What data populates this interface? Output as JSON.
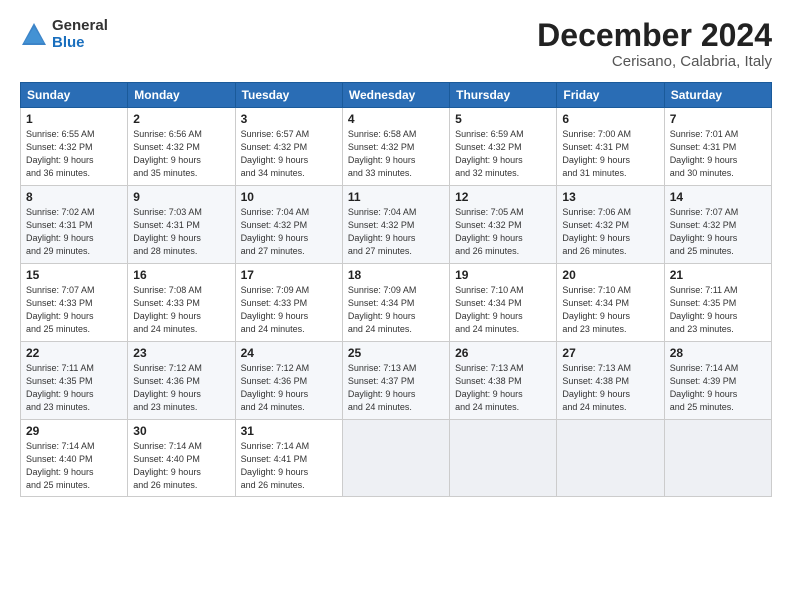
{
  "logo": {
    "general": "General",
    "blue": "Blue"
  },
  "title": "December 2024",
  "subtitle": "Cerisano, Calabria, Italy",
  "header_days": [
    "Sunday",
    "Monday",
    "Tuesday",
    "Wednesday",
    "Thursday",
    "Friday",
    "Saturday"
  ],
  "weeks": [
    [
      {
        "day": "1",
        "detail": "Sunrise: 6:55 AM\nSunset: 4:32 PM\nDaylight: 9 hours\nand 36 minutes."
      },
      {
        "day": "2",
        "detail": "Sunrise: 6:56 AM\nSunset: 4:32 PM\nDaylight: 9 hours\nand 35 minutes."
      },
      {
        "day": "3",
        "detail": "Sunrise: 6:57 AM\nSunset: 4:32 PM\nDaylight: 9 hours\nand 34 minutes."
      },
      {
        "day": "4",
        "detail": "Sunrise: 6:58 AM\nSunset: 4:32 PM\nDaylight: 9 hours\nand 33 minutes."
      },
      {
        "day": "5",
        "detail": "Sunrise: 6:59 AM\nSunset: 4:32 PM\nDaylight: 9 hours\nand 32 minutes."
      },
      {
        "day": "6",
        "detail": "Sunrise: 7:00 AM\nSunset: 4:31 PM\nDaylight: 9 hours\nand 31 minutes."
      },
      {
        "day": "7",
        "detail": "Sunrise: 7:01 AM\nSunset: 4:31 PM\nDaylight: 9 hours\nand 30 minutes."
      }
    ],
    [
      {
        "day": "8",
        "detail": "Sunrise: 7:02 AM\nSunset: 4:31 PM\nDaylight: 9 hours\nand 29 minutes."
      },
      {
        "day": "9",
        "detail": "Sunrise: 7:03 AM\nSunset: 4:31 PM\nDaylight: 9 hours\nand 28 minutes."
      },
      {
        "day": "10",
        "detail": "Sunrise: 7:04 AM\nSunset: 4:32 PM\nDaylight: 9 hours\nand 27 minutes."
      },
      {
        "day": "11",
        "detail": "Sunrise: 7:04 AM\nSunset: 4:32 PM\nDaylight: 9 hours\nand 27 minutes."
      },
      {
        "day": "12",
        "detail": "Sunrise: 7:05 AM\nSunset: 4:32 PM\nDaylight: 9 hours\nand 26 minutes."
      },
      {
        "day": "13",
        "detail": "Sunrise: 7:06 AM\nSunset: 4:32 PM\nDaylight: 9 hours\nand 26 minutes."
      },
      {
        "day": "14",
        "detail": "Sunrise: 7:07 AM\nSunset: 4:32 PM\nDaylight: 9 hours\nand 25 minutes."
      }
    ],
    [
      {
        "day": "15",
        "detail": "Sunrise: 7:07 AM\nSunset: 4:33 PM\nDaylight: 9 hours\nand 25 minutes."
      },
      {
        "day": "16",
        "detail": "Sunrise: 7:08 AM\nSunset: 4:33 PM\nDaylight: 9 hours\nand 24 minutes."
      },
      {
        "day": "17",
        "detail": "Sunrise: 7:09 AM\nSunset: 4:33 PM\nDaylight: 9 hours\nand 24 minutes."
      },
      {
        "day": "18",
        "detail": "Sunrise: 7:09 AM\nSunset: 4:34 PM\nDaylight: 9 hours\nand 24 minutes."
      },
      {
        "day": "19",
        "detail": "Sunrise: 7:10 AM\nSunset: 4:34 PM\nDaylight: 9 hours\nand 24 minutes."
      },
      {
        "day": "20",
        "detail": "Sunrise: 7:10 AM\nSunset: 4:34 PM\nDaylight: 9 hours\nand 23 minutes."
      },
      {
        "day": "21",
        "detail": "Sunrise: 7:11 AM\nSunset: 4:35 PM\nDaylight: 9 hours\nand 23 minutes."
      }
    ],
    [
      {
        "day": "22",
        "detail": "Sunrise: 7:11 AM\nSunset: 4:35 PM\nDaylight: 9 hours\nand 23 minutes."
      },
      {
        "day": "23",
        "detail": "Sunrise: 7:12 AM\nSunset: 4:36 PM\nDaylight: 9 hours\nand 23 minutes."
      },
      {
        "day": "24",
        "detail": "Sunrise: 7:12 AM\nSunset: 4:36 PM\nDaylight: 9 hours\nand 24 minutes."
      },
      {
        "day": "25",
        "detail": "Sunrise: 7:13 AM\nSunset: 4:37 PM\nDaylight: 9 hours\nand 24 minutes."
      },
      {
        "day": "26",
        "detail": "Sunrise: 7:13 AM\nSunset: 4:38 PM\nDaylight: 9 hours\nand 24 minutes."
      },
      {
        "day": "27",
        "detail": "Sunrise: 7:13 AM\nSunset: 4:38 PM\nDaylight: 9 hours\nand 24 minutes."
      },
      {
        "day": "28",
        "detail": "Sunrise: 7:14 AM\nSunset: 4:39 PM\nDaylight: 9 hours\nand 25 minutes."
      }
    ],
    [
      {
        "day": "29",
        "detail": "Sunrise: 7:14 AM\nSunset: 4:40 PM\nDaylight: 9 hours\nand 25 minutes."
      },
      {
        "day": "30",
        "detail": "Sunrise: 7:14 AM\nSunset: 4:40 PM\nDaylight: 9 hours\nand 26 minutes."
      },
      {
        "day": "31",
        "detail": "Sunrise: 7:14 AM\nSunset: 4:41 PM\nDaylight: 9 hours\nand 26 minutes."
      },
      {
        "day": "",
        "detail": ""
      },
      {
        "day": "",
        "detail": ""
      },
      {
        "day": "",
        "detail": ""
      },
      {
        "day": "",
        "detail": ""
      }
    ]
  ]
}
